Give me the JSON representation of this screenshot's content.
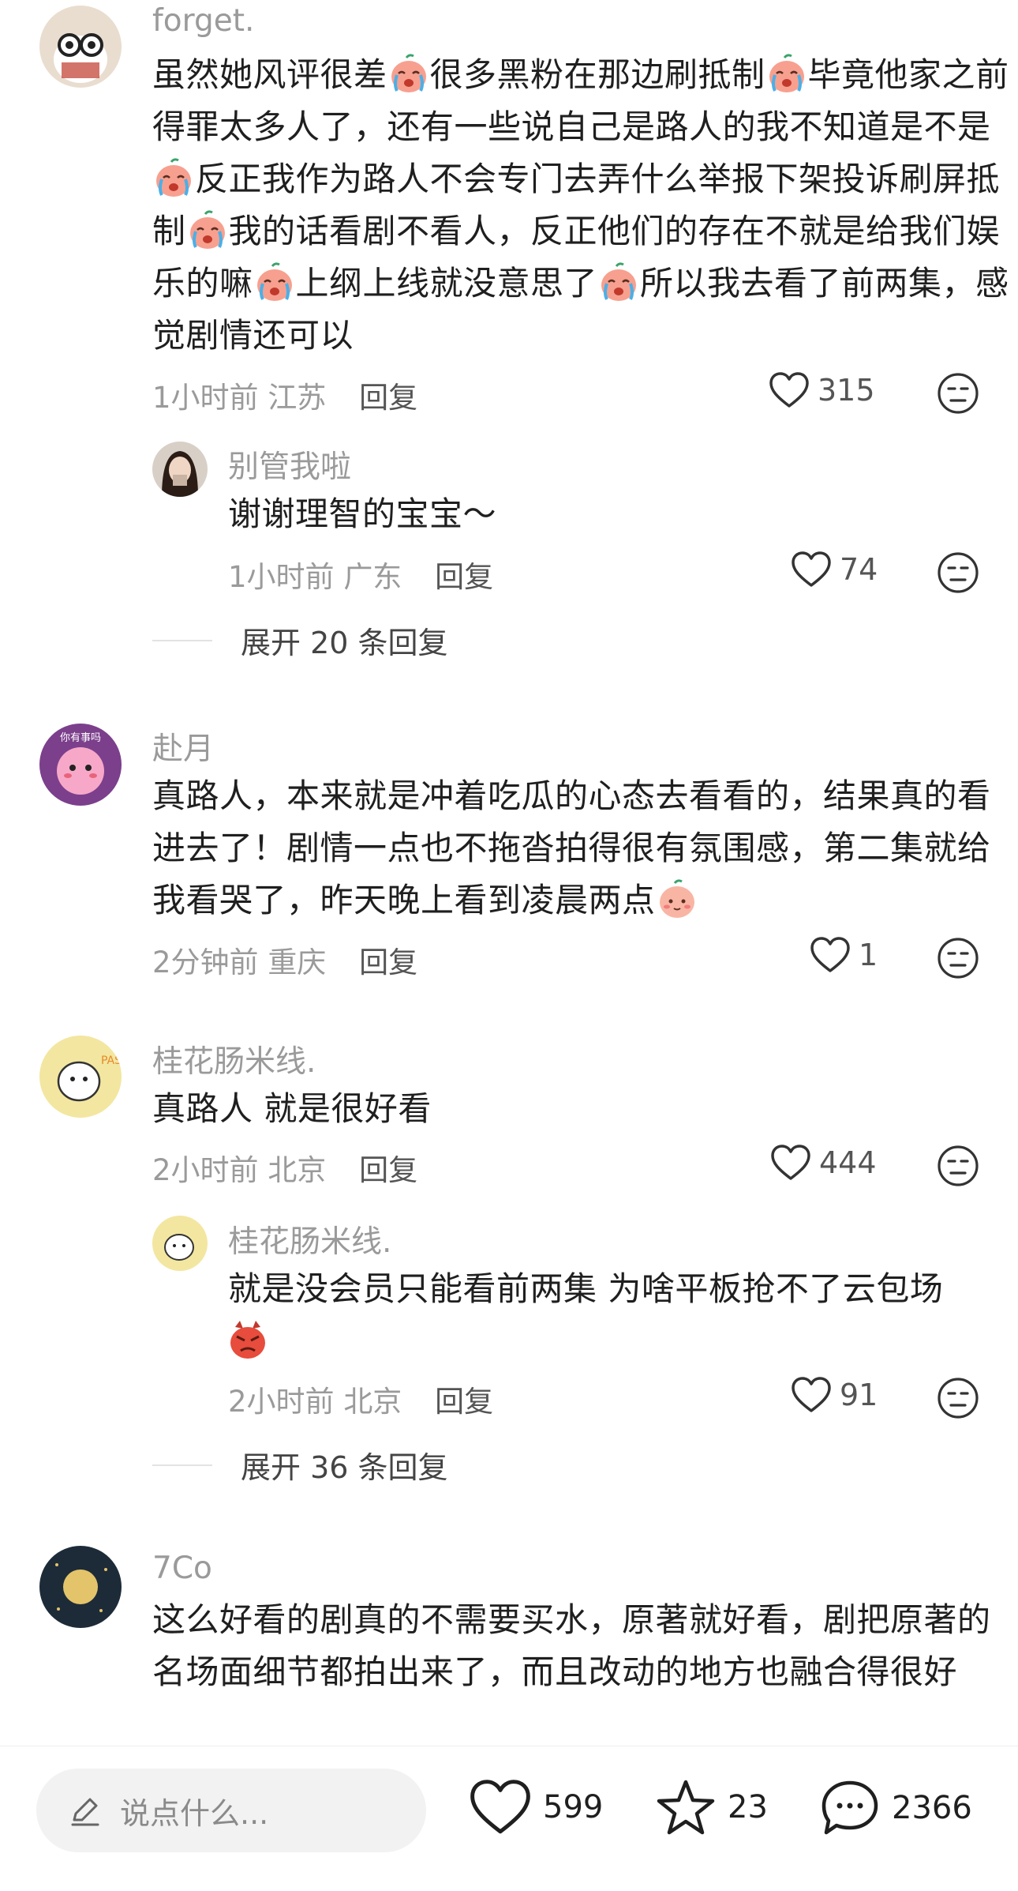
{
  "comments": [
    {
      "username": "forget.",
      "text_parts": [
        "虽然她风评很差",
        "[cry]",
        "很多黑粉在那边刷抵制",
        "[cry]",
        "毕竟他家之前得罪太多人了，还有一些说自己是路人的我不知道是不是",
        "[cry]",
        "反正我作为路人不会专门去弄什么举报下架投诉刷屏抵制",
        "[cry]",
        "我的话看剧不看人，反正他们的存在不就是给我们娱乐的嘛",
        "[cry]",
        "上纲上线就没意思了",
        "[cry]",
        "所以我去看了前两集，感觉剧情还可以"
      ],
      "time": "1小时前",
      "location": "江苏",
      "reply_label": "回复",
      "likes": "315",
      "sub_reply": {
        "username": "别管我啦",
        "text": "谢谢理智的宝宝～",
        "time": "1小时前",
        "location": "广东",
        "reply_label": "回复",
        "likes": "74"
      },
      "expand_label": "展开 20 条回复"
    },
    {
      "username": "赴月",
      "avatar_text": "你有事吗",
      "text_parts": [
        "真路人，本来就是冲着吃瓜的心态去看看的，结果真的看进去了！剧情一点也不拖沓拍得很有氛围感，第二集就给我看哭了，昨天晚上看到凌晨两点",
        "[shy]"
      ],
      "time": "2分钟前",
      "location": "重庆",
      "reply_label": "回复",
      "likes": "1"
    },
    {
      "username": "桂花肠米线.",
      "avatar_text": "PASS",
      "text": "真路人 就是很好看",
      "time": "2小时前",
      "location": "北京",
      "reply_label": "回复",
      "likes": "444",
      "sub_reply": {
        "username": "桂花肠米线.",
        "text": "就是没会员只能看前两集 为啥平板抢不了云包场",
        "time": "2小时前",
        "location": "北京",
        "reply_label": "回复",
        "likes": "91"
      },
      "expand_label": "展开 36 条回复"
    },
    {
      "username": "7Co",
      "text": "这么好看的剧真的不需要买水，原著就好看，剧把原著的名场面细节都拍出来了，而且改动的地方也融合得很好"
    }
  ],
  "bottom_bar": {
    "input_placeholder": "说点什么...",
    "likes": "599",
    "favorites": "23",
    "comments": "2366"
  },
  "icons": [
    "heart-icon",
    "dislike-face-icon",
    "star-icon",
    "chat-bubble-icon",
    "pen-icon",
    "cry-emoji",
    "shy-emoji",
    "angry-emoji"
  ],
  "colors": {
    "text": "#1f1f1f",
    "meta": "#9a9a9a",
    "accent_emoji": "#f26b62"
  }
}
